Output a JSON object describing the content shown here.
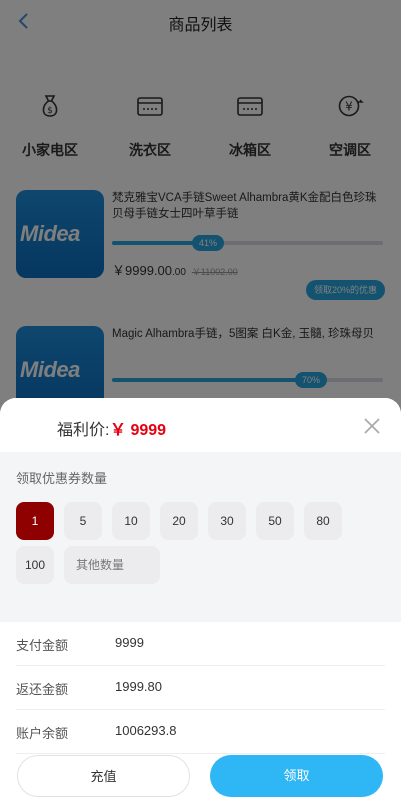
{
  "nav": {
    "title": "商品列表"
  },
  "categories": [
    {
      "label": "小家电区",
      "icon": "money-bag-icon"
    },
    {
      "label": "洗衣区",
      "icon": "washer-icon"
    },
    {
      "label": "冰箱区",
      "icon": "fridge-icon"
    },
    {
      "label": "空调区",
      "icon": "yen-exchange-icon"
    }
  ],
  "products": [
    {
      "brand": "Midea",
      "name": "梵克雅宝VCA手链Sweet Alhambra黄K金配白色珍珠贝母手链女士四叶草手链",
      "progress_label": "41%",
      "progress": 0.41,
      "price_int": "￥9999.00",
      "price_dec": ".00",
      "orig_price": "￥11002.00",
      "promo": "领取20%的优惠"
    },
    {
      "brand": "Midea",
      "name": "Magic Alhambra手链，5图案 白K金, 玉髓, 珍珠母贝",
      "progress_label": "70%",
      "progress": 0.7
    }
  ],
  "sheet": {
    "price_label": "福利价:",
    "price": "￥ 9999",
    "section_title": "领取优惠券数量",
    "quantities": [
      "1",
      "5",
      "10",
      "20",
      "30",
      "50",
      "80",
      "100"
    ],
    "other_quantity": "其他数量",
    "selected_quantity": "1",
    "pay_label": "支付金额",
    "pay_value": "9999",
    "rebate_label": "返还金额",
    "rebate_value": "1999.80",
    "balance_label": "账户余额",
    "balance_value": "1006293.8",
    "recharge_button": "充值",
    "claim_button": "领取"
  },
  "colors": {
    "accent": "#2fb6f5",
    "selected": "#8f0000",
    "price": "#e60012"
  }
}
